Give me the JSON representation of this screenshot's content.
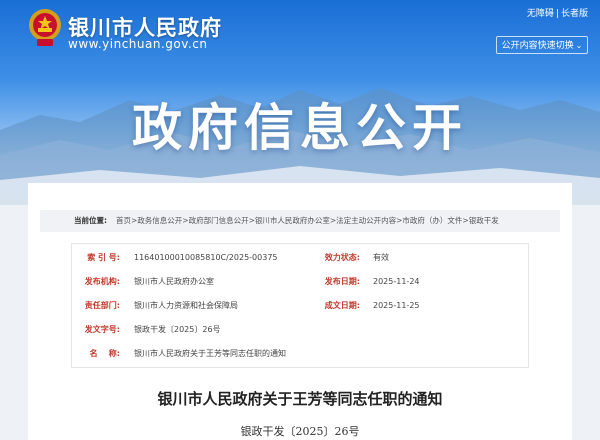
{
  "header": {
    "site_name": "银川市人民政府",
    "site_url": "www.yinchuan.gov.cn",
    "accessibility_link": "无障碍",
    "separator": "|",
    "elderly_link": "长者版",
    "quick_switch_label": "公开内容快速切换",
    "hero_title": "政府信息公开"
  },
  "breadcrumb": {
    "label": "当前位置:",
    "path": "首页>政务信息公开>政府部门信息公开>银川市人民政府办公室>法定主动公开内容>市政府（办）文件>银政干发"
  },
  "meta": [
    {
      "label": "索 引 号:",
      "value": "11640100010085810C/2025-00375"
    },
    {
      "label": "效力状态:",
      "value": "有效"
    },
    {
      "label": "发布机构:",
      "value": "银川市人民政府办公室"
    },
    {
      "label": "发布日期:",
      "value": "2025-11-24"
    },
    {
      "label": "责任部门:",
      "value": "银川市人力资源和社会保障局"
    },
    {
      "label": "成文日期:",
      "value": "2025-11-25"
    },
    {
      "label": "发文字号:",
      "value": "银政干发〔2025〕26号"
    },
    {
      "label": "名    称:",
      "value": "银川市人民政府关于王芳等同志任职的通知"
    }
  ],
  "document": {
    "title": "银川市人民政府关于王芳等同志任职的通知",
    "number": "银政干发〔2025〕26号"
  },
  "colors": {
    "label_red": "#c0392b",
    "banner_blue": "#1a6fd6"
  }
}
